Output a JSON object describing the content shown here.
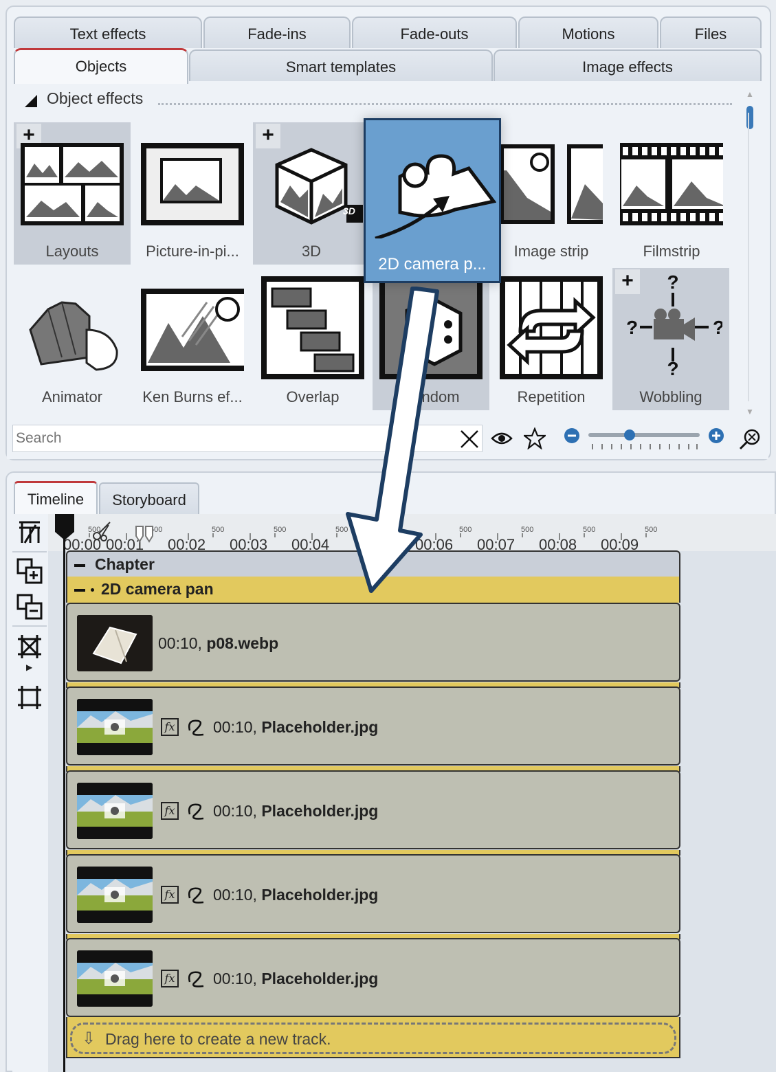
{
  "tabs_row1": [
    "Text effects",
    "Fade-ins",
    "Fade-outs",
    "Motions",
    "Files"
  ],
  "tabs_row2": [
    "Objects",
    "Smart templates",
    "Image effects"
  ],
  "section_title": "Object effects",
  "tiles": [
    {
      "label": "Layouts",
      "icon": "layouts-icon"
    },
    {
      "label": "Picture-in-pi...",
      "icon": "picture-in-picture-icon"
    },
    {
      "label": "3D",
      "icon": "3d-cube-icon"
    },
    {
      "label": "2D camera p...",
      "icon": "camera-pan-icon"
    },
    {
      "label": "Image strip",
      "icon": "image-strip-icon"
    },
    {
      "label": "Filmstrip",
      "icon": "filmstrip-icon"
    },
    {
      "label": "Animator",
      "icon": "flipbook-icon"
    },
    {
      "label": "Ken Burns ef...",
      "icon": "ken-burns-icon"
    },
    {
      "label": "Overlap",
      "icon": "overlap-icon"
    },
    {
      "label": "Random",
      "icon": "dice-icon"
    },
    {
      "label": "Repetition",
      "icon": "repetition-icon"
    },
    {
      "label": "Wobbling",
      "icon": "wobbling-camera-icon"
    }
  ],
  "popup_label": "2D camera p...",
  "badge_3d": "3D",
  "search": {
    "placeholder": "Search"
  },
  "bottom_tabs": [
    "Timeline",
    "Storyboard"
  ],
  "ruler": {
    "majors": [
      "00:00",
      "00:01",
      "00:02",
      "00:03",
      "00:04",
      "00:06",
      "00:07",
      "00:08",
      "00:09"
    ],
    "minor": "500"
  },
  "chapter_label": "Chapter",
  "pan_label": "2D camera pan",
  "clips": [
    {
      "time": "00:10,",
      "name": "p08.webp",
      "fx": false
    },
    {
      "time": "00:10,",
      "name": "Placeholder.jpg",
      "fx": true
    },
    {
      "time": "00:10,",
      "name": "Placeholder.jpg",
      "fx": true
    },
    {
      "time": "00:10,",
      "name": "Placeholder.jpg",
      "fx": true
    },
    {
      "time": "00:10,",
      "name": "Placeholder.jpg",
      "fx": true
    }
  ],
  "fx_label": "fx",
  "drag_hint": "Drag here to create a new track.",
  "colors": {
    "accent_tab": "#c0393b",
    "popup": "#6a9fcf",
    "pan_track": "#e2c95e",
    "clip": "#bebfb2",
    "arrow": "#1d3d62"
  }
}
